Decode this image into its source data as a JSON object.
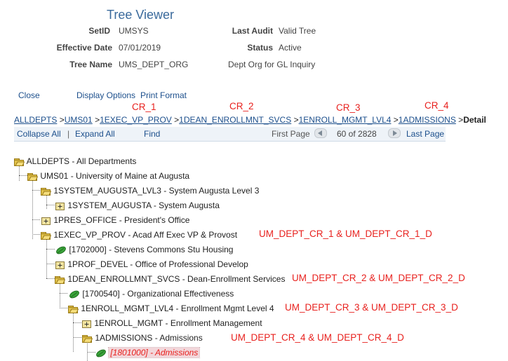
{
  "header": {
    "title": "Tree Viewer",
    "setid_label": "SetID",
    "setid_value": "UMSYS",
    "last_audit_label": "Last Audit",
    "last_audit_value": "Valid Tree",
    "eff_date_label": "Effective Date",
    "eff_date_value": "07/01/2019",
    "status_label": "Status",
    "status_value": "Active",
    "tree_name_label": "Tree Name",
    "tree_name_value": "UMS_DEPT_ORG",
    "tree_desc": "Dept Org for GL Inquiry"
  },
  "actions": {
    "close": "Close",
    "display_options": "Display Options",
    "print_format": "Print Format"
  },
  "cr_labels": [
    "CR_1",
    "CR_2",
    "CR_3",
    "CR_4"
  ],
  "breadcrumb": {
    "items": [
      "ALLDEPTS",
      "UMS01",
      "1EXEC_VP_PROV",
      "1DEAN_ENROLLMNT_SVCS",
      "1ENROLL_MGMT_LVL4",
      "1ADMISSIONS"
    ],
    "separator": ">",
    "current": "Detail"
  },
  "toolbar": {
    "collapse_all": "Collapse All",
    "separator": "|",
    "expand_all": "Expand All",
    "find": "Find",
    "first_page": "First Page",
    "page_info": "60 of 2828",
    "last_page": "Last Page"
  },
  "tree": [
    {
      "text": "ALLDEPTS - All Departments"
    },
    {
      "text": "UMS01 - University of Maine at Augusta"
    },
    {
      "text": "1SYSTEM_AUGUSTA_LVL3 - System Augusta Level 3"
    },
    {
      "text": "1SYSTEM_AUGUSTA - System Augusta"
    },
    {
      "text": "1PRES_OFFICE - President's Office"
    },
    {
      "text": "1EXEC_VP_PROV - Acad Aff Exec VP & Provost"
    },
    {
      "text": "[1702000] - Stevens Commons Stu Housing"
    },
    {
      "text": "1PROF_DEVEL - Office of Professional Develop"
    },
    {
      "text": "1DEAN_ENROLLMNT_SVCS - Dean-Enrollment Services"
    },
    {
      "text": "[1700540] - Organizational Effectiveness"
    },
    {
      "text": "1ENROLL_MGMT_LVL4 - Enrollment Mgmt Level 4"
    },
    {
      "text": "1ENROLL_MGMT - Enrollment Management"
    },
    {
      "text": "1ADMISSIONS - Admissions"
    },
    {
      "text": "[1801000] - Admissions"
    }
  ],
  "annotations": [
    "UM_DEPT_CR_1 & UM_DEPT_CR_1_D",
    "UM_DEPT_CR_2 & UM_DEPT_CR_2_D",
    "UM_DEPT_CR_3 & UM_DEPT_CR_3_D",
    "UM_DEPT_CR_4 & UM_DEPT_CR_4_D"
  ],
  "colors": {
    "link": "#1c4f8c",
    "annotation": "#e8211e",
    "folder": "#e2c24a",
    "leaf": "#3aa33a",
    "title": "#3a6a9c"
  }
}
